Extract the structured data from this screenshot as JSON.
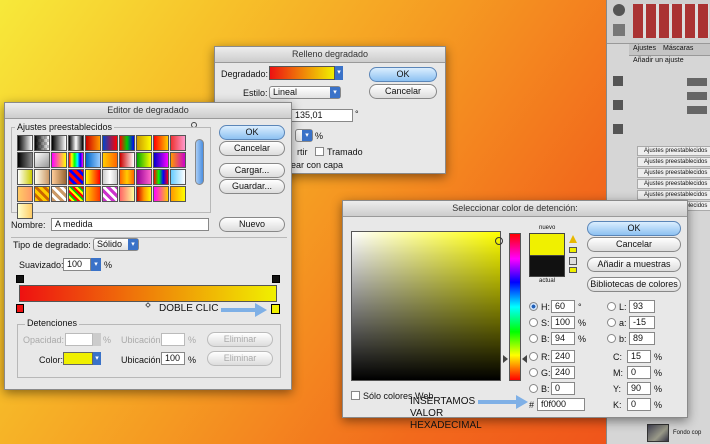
{
  "relleno": {
    "title": "Relleno degradado",
    "degradado_label": "Degradado:",
    "estilo_label": "Estilo:",
    "estilo_value": "Lineal",
    "angle_value": "135,01",
    "deg_symbol": "°",
    "percent": "%",
    "invertir_partial": "rtir",
    "tramado": "Tramado",
    "alinear_partial": "ear con capa",
    "ok": "OK",
    "cancelar": "Cancelar"
  },
  "editor": {
    "title": "Editor de degradado",
    "presets_label": "Ajustes preestablecidos",
    "ok": "OK",
    "cancelar": "Cancelar",
    "cargar": "Cargar...",
    "guardar": "Guardar...",
    "nombre_label": "Nombre:",
    "nombre_value": "A medida",
    "nuevo": "Nuevo",
    "tipo_label": "Tipo de degradado:",
    "tipo_value": "Sólido",
    "suavizado_label": "Suavizado:",
    "suavizado_value": "100",
    "percent": "%",
    "detenciones_label": "Detenciones",
    "opacidad_label": "Opacidad:",
    "ubicacion_label": "Ubicación:",
    "eliminar": "Eliminar",
    "color_label": "Color:",
    "ubicacion_value": "100",
    "doble_clic": "DOBLE CLIC"
  },
  "picker": {
    "title": "Seleccionar color de detención:",
    "nuevo": "nuevo",
    "actual": "actual",
    "ok": "OK",
    "cancelar": "Cancelar",
    "anadir": "Añadir a muestras",
    "bibliotecas": "Bibliotecas de colores",
    "fields": {
      "H": "60",
      "S": "100",
      "B": "94",
      "R": "240",
      "G": "240",
      "Bl": "0",
      "L": "93",
      "a": "-15",
      "b": "89",
      "C": "15",
      "M": "0",
      "Y": "90",
      "K": "0"
    },
    "labels": {
      "H": "H:",
      "S": "S:",
      "B": "B:",
      "R": "R:",
      "G": "G:",
      "Bl": "B:",
      "L": "L:",
      "a": "a:",
      "b": "b:",
      "C": "C:",
      "M": "M:",
      "Y": "Y:",
      "K": "K:"
    },
    "deg": "°",
    "percent": "%",
    "web_only": "Sólo colores Web",
    "hash": "#",
    "hex_value": "f0f000",
    "insertamos": [
      "INSERTAMOS",
      "VALOR",
      "HEXADECIMAL"
    ]
  },
  "panel": {
    "tab_ajustes": "Ajustes",
    "tab_mascaras": "Máscaras",
    "subtitle": "Añadir un ajuste",
    "rows": [
      "Ajustes preestablecidos",
      "Ajustes preestablecidos",
      "Ajustes preestablecidos",
      "Ajustes preestablecidos",
      "Ajustes preestablecidos",
      "Ajustes preestablecidos"
    ],
    "layer_name": "Fondo cop"
  },
  "colors": {
    "stop_yellow": "#f0f000",
    "stop_red": "#ee1111",
    "accent_blue": "#3a72c8"
  }
}
